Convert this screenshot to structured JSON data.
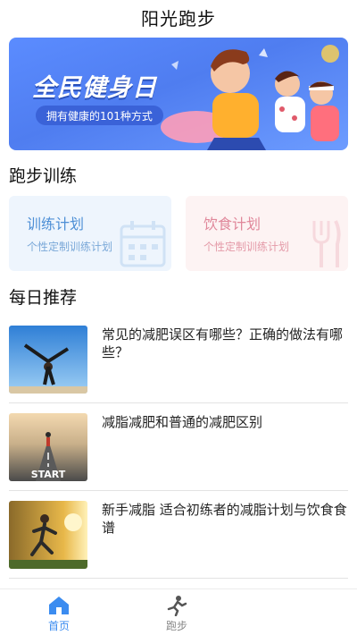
{
  "header": {
    "title": "阳光跑步"
  },
  "banner": {
    "title": "全民健身日",
    "subtitle": "拥有健康的101种方式"
  },
  "training": {
    "section_title": "跑步训练",
    "cards": [
      {
        "title": "训练计划",
        "subtitle": "个性定制训练计划",
        "icon": "calendar-icon"
      },
      {
        "title": "饮食计划",
        "subtitle": "个性定制训练计划",
        "icon": "fork-icon"
      }
    ]
  },
  "recommend": {
    "section_title": "每日推荐",
    "articles": [
      {
        "title": "常见的减肥误区有哪些？正确的做法有哪些？"
      },
      {
        "title": "减脂减肥和普通的减肥区别",
        "thumb_text": "START"
      },
      {
        "title": "新手减脂 适合初练者的减脂计划与饮食食谱"
      }
    ]
  },
  "tabbar": {
    "items": [
      {
        "label": "首页",
        "icon": "home-icon",
        "active": true
      },
      {
        "label": "跑步",
        "icon": "running-icon",
        "active": false
      }
    ]
  },
  "colors": {
    "accent": "#3b8cf0",
    "banner": "#5b8cff",
    "diet": "#e0879a"
  }
}
